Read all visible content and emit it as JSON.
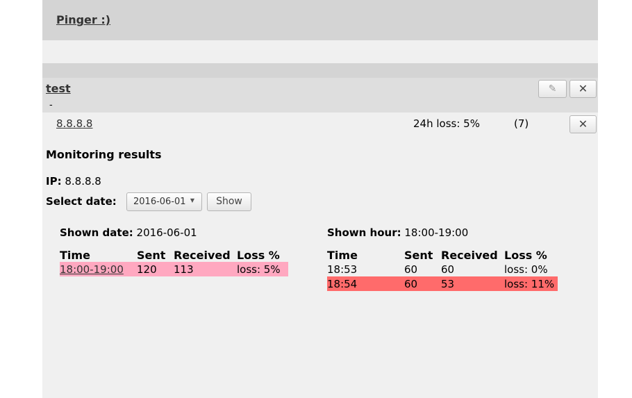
{
  "app": {
    "title": "Pinger :)"
  },
  "group": {
    "name": "test",
    "description": "-",
    "edit_icon": "✎",
    "delete_icon": "✕"
  },
  "host": {
    "ip": "8.8.8.8",
    "loss": "24h loss: 5%",
    "count": "(7)",
    "delete_icon": "✕"
  },
  "monitoring": {
    "title": "Monitoring results",
    "ip_label": "IP:",
    "ip_value": "8.8.8.8",
    "select_date_label": "Select date:",
    "selected_date": "2016-06-01",
    "show_button": "Show"
  },
  "daily": {
    "shown_label": "Shown date:",
    "shown_value": "2016-06-01",
    "headers": [
      "Time",
      "Sent",
      "Received",
      "Loss %"
    ],
    "rows": [
      {
        "time": "18:00-19:00",
        "sent": "120",
        "received": "113",
        "loss": "loss: 5%"
      }
    ]
  },
  "hourly": {
    "shown_label": "Shown hour:",
    "shown_value": "18:00-19:00",
    "headers": [
      "Time",
      "Sent",
      "Received",
      "Loss %"
    ],
    "rows": [
      {
        "time": "18:53",
        "sent": "60",
        "received": "60",
        "loss": "loss: 0%"
      },
      {
        "time": "18:54",
        "sent": "60",
        "received": "53",
        "loss": "loss: 11%"
      }
    ]
  },
  "colors": {
    "warn_row": "#ffa8c0",
    "alert_row": "#ff6b6b",
    "header_bg": "#d4d4d4",
    "page_bg": "#f0f0f0"
  }
}
